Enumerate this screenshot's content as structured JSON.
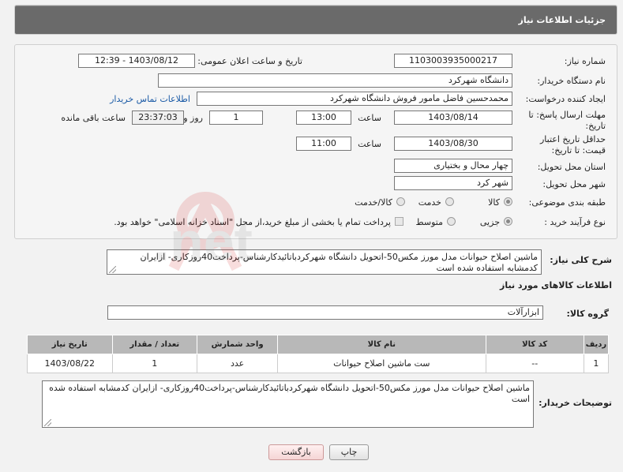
{
  "header": {
    "title": "جزئیات اطلاعات نیاز"
  },
  "form": {
    "need_number": {
      "label": "شماره نیاز:",
      "value": "1103003935000217"
    },
    "announce_datetime": {
      "label": "تاریخ و ساعت اعلان عمومی:",
      "value": "1403/08/12 - 12:39"
    },
    "buyer_org": {
      "label": "نام دستگاه خریدار:",
      "value": "دانشگاه شهرکرد"
    },
    "requester": {
      "label": "ایجاد کننده درخواست:",
      "value": "محمدحسین فاضل مامور فروش دانشگاه شهرکرد",
      "contact_link": "اطلاعات تماس خریدار"
    },
    "deadline": {
      "label": "مهلت ارسال پاسخ: تا تاریخ:",
      "date": "1403/08/14",
      "time_label": "ساعت",
      "time": "13:00",
      "days": "1",
      "days_label": "روز و",
      "remaining": "23:37:03",
      "remaining_label": "ساعت باقی مانده"
    },
    "validity": {
      "label": "حداقل تاریخ اعتبار قیمت: تا تاریخ:",
      "date": "1403/08/30",
      "time_label": "ساعت",
      "time": "11:00"
    },
    "province": {
      "label": "استان محل تحویل:",
      "value": "چهار محال و بختیاری"
    },
    "city": {
      "label": "شهر محل تحویل:",
      "value": "شهر کرد"
    },
    "category": {
      "label": "طبقه بندی موضوعی:",
      "options": [
        "کالا",
        "خدمت",
        "کالا/خدمت"
      ],
      "selected": "کالا"
    },
    "process_type": {
      "label": "نوع فرآیند خرید :",
      "options": [
        "جزیی",
        "متوسط"
      ],
      "selected": "جزیی",
      "note": "پرداخت تمام یا بخشی از مبلغ خرید،از محل \"اسناد خزانه اسلامی\" خواهد بود."
    }
  },
  "summary": {
    "label": "شرح کلی نیاز:",
    "text": "ماشین اصلاح حیوانات مدل مورز مکس50-اتحویل دانشگاه شهرکردباتائیدکارشناس-پرداخت40روزکاری- ازایران کدمشابه استفاده شده است"
  },
  "goods_section": {
    "title": "اطلاعات کالاهای مورد نیاز"
  },
  "goods_group": {
    "label": "گروه کالا:",
    "value": "ابزارآلات"
  },
  "table": {
    "headers": [
      "ردیف",
      "کد کالا",
      "نام کالا",
      "واحد شمارش",
      "تعداد / مقدار",
      "تاریخ نیاز"
    ],
    "rows": [
      [
        "1",
        "--",
        "ست ماشین اصلاح حیوانات",
        "عدد",
        "1",
        "1403/08/22"
      ]
    ]
  },
  "buyer_notes": {
    "label": "توضیحات خریدار:",
    "text": "ماشین اصلاح حیوانات مدل مورز مکس50-اتحویل دانشگاه شهرکردباتائیدکارشناس-پرداخت40روزکاری- ازایران کدمشابه استفاده شده است"
  },
  "buttons": {
    "print": "چاپ",
    "back": "بازگشت"
  },
  "watermark": {
    "text": "AriaTender.net"
  },
  "colors": {
    "header_bg": "#6a6a6a",
    "table_header_bg": "#b8b8b8",
    "link": "#1a5aa6"
  }
}
